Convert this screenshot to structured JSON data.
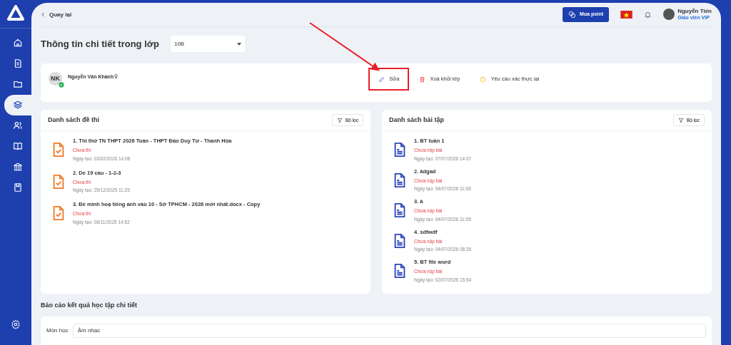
{
  "sidebar": {
    "items": [
      {
        "kind": "home",
        "selected": false
      },
      {
        "kind": "document",
        "selected": false
      },
      {
        "kind": "folder",
        "selected": false
      },
      {
        "kind": "layers",
        "selected": true
      },
      {
        "kind": "users",
        "selected": false
      },
      {
        "kind": "book",
        "selected": false
      },
      {
        "kind": "bank",
        "selected": false
      },
      {
        "kind": "save",
        "selected": false
      }
    ]
  },
  "topbar": {
    "back": "Quay lại",
    "buy_button": "Mua point",
    "user": {
      "name": "Nguyễn Tiến",
      "role": "Giáo viên VIP"
    }
  },
  "page_title": "Thông tin chi tiết trong lớp",
  "class_select": {
    "value": "10B"
  },
  "student": {
    "initials": "NK",
    "name": "Nguyễn Văn Khánh",
    "verified": true,
    "actions": [
      {
        "kind": "edit",
        "label": "Sửa",
        "highlighted": true
      },
      {
        "kind": "delete",
        "label": "Xoá khỏi lớp",
        "highlighted": false
      },
      {
        "kind": "warning",
        "label": "Yêu cầu xác thực lại",
        "highlighted": false
      }
    ]
  },
  "exams": {
    "title": "Danh sách đề thi",
    "filter": "Bộ lọc",
    "items": [
      {
        "title": "1. Thi thử TN THPT 2026 Toán - THPT Đào Duy Từ - Thanh Hóa",
        "status": "Chưa thi",
        "date": "Ngày tạo: 03/02/2026 14:08"
      },
      {
        "title": "2. De 19 cau - 1-2-3",
        "status": "Chưa thi",
        "date": "Ngày tạo: 25/12/2025 11:25"
      },
      {
        "title": "3. Đề minh hoạ tiếng anh vào 10 - Sở TPHCM - 2026 mới nhất.docx - Copy",
        "status": "Chưa thi",
        "date": "Ngày tạo: 06/11/2025 14:52"
      }
    ]
  },
  "assignments": {
    "title": "Danh sách bài tập",
    "filter": "Bộ lọc",
    "items": [
      {
        "title": "1. BT tuần 1",
        "status": "Chưa nộp bài",
        "date": "Ngày tạo: 07/07/2026 14:07"
      },
      {
        "title": "2. ădgad",
        "status": "Chưa nộp bài",
        "date": "Ngày tạo: 04/07/2026 11:06"
      },
      {
        "title": "3. à",
        "status": "Chưa nộp bài",
        "date": "Ngày tạo: 04/07/2026 11:05"
      },
      {
        "title": "4. sdfwdf",
        "status": "Chưa nộp bài",
        "date": "Ngày tạo: 04/07/2026 08:26"
      },
      {
        "title": "5. BT file word",
        "status": "Chưa nộp bài",
        "date": "Ngày tạo: 02/07/2026 15:54"
      }
    ]
  },
  "report": {
    "title": "Báo cáo kết quả học tập chi tiết",
    "subject_label": "Môn học",
    "subject_value": "Âm nhạc"
  }
}
